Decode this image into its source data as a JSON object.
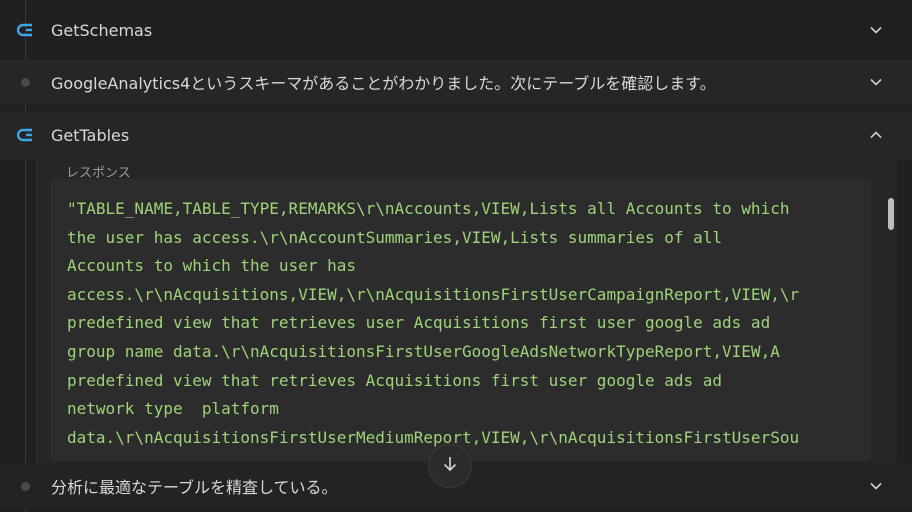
{
  "steps": [
    {
      "label": "GetSchemas",
      "icon": "tool-icon",
      "expanded": false
    },
    {
      "label": "GoogleAnalytics4というスキーマがあることがわかりました。次にテーブルを確認します。",
      "icon": "dot-icon",
      "expanded": false
    },
    {
      "label": "GetTables",
      "icon": "tool-icon",
      "expanded": true
    },
    {
      "label": "分析に最適なテーブルを精査している。",
      "icon": "dot-icon",
      "expanded": false
    }
  ],
  "response": {
    "label": "レスポンス",
    "lines": [
      "\"TABLE_NAME,TABLE_TYPE,REMARKS\\r\\nAccounts,VIEW,Lists all Accounts to which",
      "the user has access.\\r\\nAccountSummaries,VIEW,Lists summaries of all",
      "Accounts to which the user has",
      "access.\\r\\nAcquisitions,VIEW,\\r\\nAcquisitionsFirstUserCampaignReport,VIEW,\\r",
      "predefined view that retrieves user Acquisitions first user google ads ad",
      "group name data.\\r\\nAcquisitionsFirstUserGoogleAdsNetworkTypeReport,VIEW,A",
      "predefined view that retrieves Acquisitions first user google ads ad",
      "network type  platform",
      "data.\\r\\nAcquisitionsFirstUserMediumReport,VIEW,\\r\\nAcquisitionsFirstUserSou"
    ]
  },
  "colors": {
    "accent": "#3ea6e6",
    "code": "#9ed37a",
    "background": "#202020"
  }
}
